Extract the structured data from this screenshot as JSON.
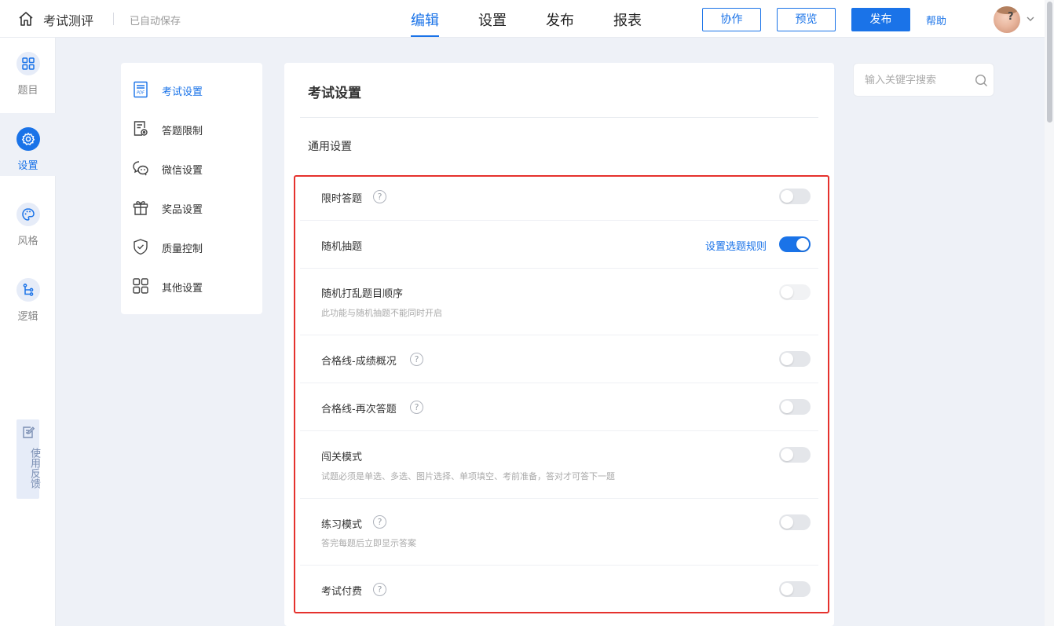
{
  "header": {
    "app_title": "考试测评",
    "autosave_status": "已自动保存",
    "tabs": [
      {
        "label": "编辑",
        "active": true
      },
      {
        "label": "设置",
        "active": false
      },
      {
        "label": "发布",
        "active": false
      },
      {
        "label": "报表",
        "active": false
      }
    ],
    "collaborate_label": "协作",
    "preview_label": "预览",
    "publish_label": "发布",
    "help_label": "帮助",
    "accent_color": "#1a73e8"
  },
  "rail": {
    "items": [
      {
        "label": "题目",
        "icon": "grid-icon",
        "active": false
      },
      {
        "label": "设置",
        "icon": "gear-icon",
        "active": true
      },
      {
        "label": "风格",
        "icon": "palette-icon",
        "active": false
      },
      {
        "label": "逻辑",
        "icon": "branch-icon",
        "active": false
      }
    ],
    "feedback_label": "使用反馈"
  },
  "settings_menu": {
    "items": [
      {
        "label": "考试设置",
        "icon": "exam-doc-icon",
        "active": true
      },
      {
        "label": "答题限制",
        "icon": "limit-doc-icon",
        "active": false
      },
      {
        "label": "微信设置",
        "icon": "wechat-icon",
        "active": false
      },
      {
        "label": "奖品设置",
        "icon": "gift-icon",
        "active": false
      },
      {
        "label": "质量控制",
        "icon": "shield-check-icon",
        "active": false
      },
      {
        "label": "其他设置",
        "icon": "apps-icon",
        "active": false
      }
    ]
  },
  "panel": {
    "title": "考试设置",
    "section_title": "通用设置",
    "rows": [
      {
        "label": "限时答题",
        "help": true,
        "desc": "",
        "toggle": "off"
      },
      {
        "label": "随机抽题",
        "help": false,
        "desc": "",
        "toggle": "on",
        "link": "设置选题规则"
      },
      {
        "label": "随机打乱题目顺序",
        "help": false,
        "desc": "此功能与随机抽题不能同时开启",
        "toggle": "disabled"
      },
      {
        "label": "合格线-成绩概况",
        "help": true,
        "desc": "",
        "toggle": "off"
      },
      {
        "label": "合格线-再次答题",
        "help": true,
        "desc": "",
        "toggle": "off"
      },
      {
        "label": "闯关模式",
        "help": false,
        "desc": "试题必须是单选、多选、图片选择、单项填空、考前准备，答对才可答下一题",
        "toggle": "off"
      },
      {
        "label": "练习模式",
        "help": true,
        "desc": "答完每题后立即显示答案",
        "toggle": "off"
      },
      {
        "label": "考试付费",
        "help": true,
        "desc": "",
        "toggle": "off"
      }
    ],
    "help_glyph": "?",
    "highlight_color": "#e5322d"
  },
  "search": {
    "placeholder": "输入关键字搜索",
    "value": ""
  }
}
